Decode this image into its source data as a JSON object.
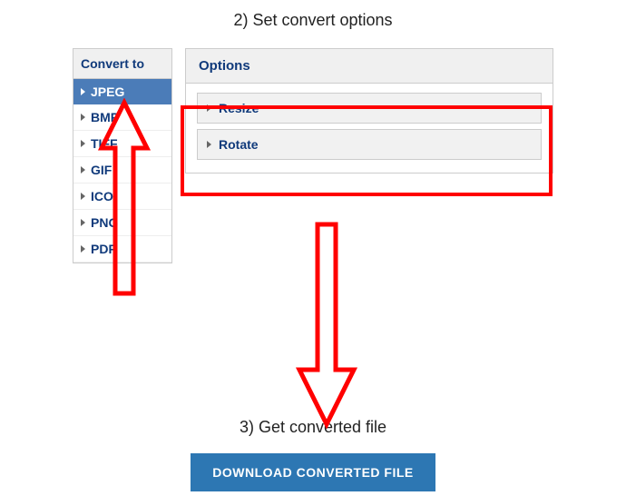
{
  "step2": {
    "title": "2) Set convert options"
  },
  "sidebar": {
    "header": "Convert to",
    "selected_index": 0,
    "formats": [
      {
        "label": "JPEG"
      },
      {
        "label": "BMP"
      },
      {
        "label": "TIFF"
      },
      {
        "label": "GIF"
      },
      {
        "label": "ICO"
      },
      {
        "label": "PNG"
      },
      {
        "label": "PDF"
      }
    ]
  },
  "options": {
    "header": "Options",
    "items": [
      {
        "label": "Resize"
      },
      {
        "label": "Rotate"
      }
    ]
  },
  "step3": {
    "title": "3) Get converted file"
  },
  "download": {
    "label": "DOWNLOAD CONVERTED FILE"
  },
  "annotations": {
    "box_over_options": true,
    "arrow_up_to_jpeg": true,
    "arrow_down_to_download": true
  },
  "colors": {
    "accent": "#2d77b3",
    "link": "#103a7b",
    "annotation": "#f00"
  }
}
